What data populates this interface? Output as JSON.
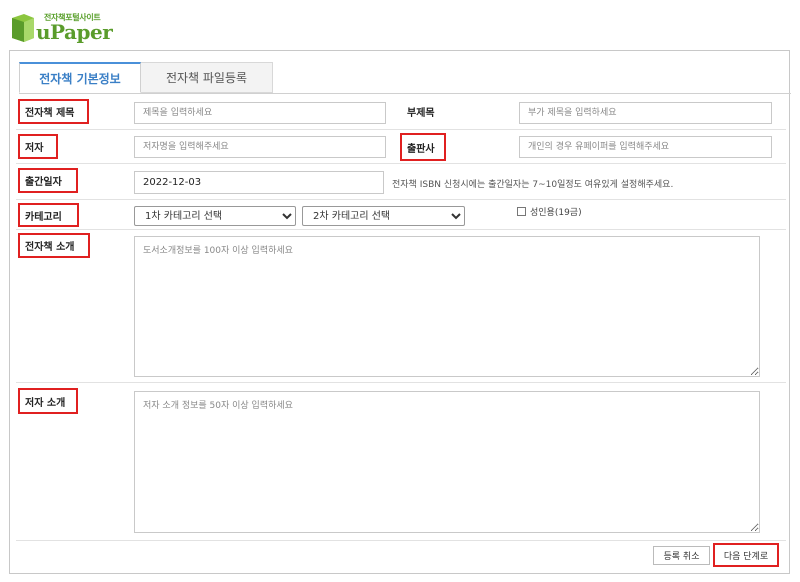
{
  "logo": {
    "subtitle": "전자책포털사이트",
    "name": "uPaper"
  },
  "tabs": [
    {
      "label": "전자책 기본정보"
    },
    {
      "label": "전자책 파일등록"
    }
  ],
  "form": {
    "title": {
      "label": "전자책 제목",
      "placeholder": "제목을 입력하세요"
    },
    "subtitle": {
      "label": "부제목",
      "placeholder": "부가 제목을 입력하세요"
    },
    "author": {
      "label": "저자",
      "placeholder": "저자명을 입력해주세요"
    },
    "publisher": {
      "label": "출판사",
      "placeholder": "개인의 경우 유페이퍼를 입력해주세요"
    },
    "pub_date": {
      "label": "출간일자",
      "value": "2022-12-03",
      "hint": "전자책 ISBN 신청시에는 출간일자는 7~10일정도 여유있게 설정해주세요."
    },
    "category": {
      "label": "카테고리",
      "cat1": "1차 카테고리 선택",
      "cat2": "2차 카테고리 선택",
      "adult_label": "성인용(19금)"
    },
    "intro": {
      "label": "전자책 소개",
      "placeholder": "도서소개정보를 100자 이상 입력하세요"
    },
    "author_intro": {
      "label": "저자 소개",
      "placeholder": "저자 소개 정보를 50자 이상 입력하세요"
    }
  },
  "buttons": {
    "cancel": "등록 취소",
    "next": "다음 단계로"
  },
  "colors": {
    "accent": "#4a90d9",
    "highlight": "#e02020",
    "brand": "#5a9c2b"
  }
}
